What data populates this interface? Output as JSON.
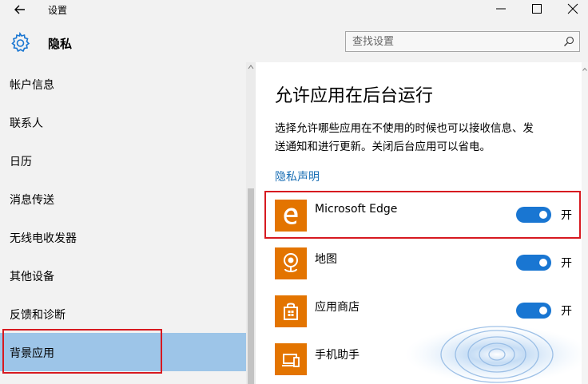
{
  "window": {
    "title": "设置",
    "back_icon": "back-arrow-icon",
    "minimize_icon": "minimize-icon",
    "maximize_icon": "maximize-icon",
    "close_icon": "close-icon"
  },
  "header": {
    "icon": "gear-icon",
    "title": "隐私"
  },
  "search": {
    "placeholder": "查找设置",
    "icon": "search-icon"
  },
  "sidebar": {
    "items": [
      {
        "label": "帐户信息",
        "active": false
      },
      {
        "label": "联系人",
        "active": false
      },
      {
        "label": "日历",
        "active": false
      },
      {
        "label": "消息传送",
        "active": false
      },
      {
        "label": "无线电收发器",
        "active": false
      },
      {
        "label": "其他设备",
        "active": false
      },
      {
        "label": "反馈和诊断",
        "active": false
      },
      {
        "label": "背景应用",
        "active": true
      }
    ]
  },
  "main": {
    "title": "允许应用在后台运行",
    "description_line1": "选择允许哪些应用在不使用的时候也可以接收信息、发",
    "description_line2": "送通知和进行更新。关闭后台应用可以省电。",
    "privacy_link": "隐私声明",
    "apps": [
      {
        "name": "Microsoft Edge",
        "icon": "edge-icon",
        "toggle_on": true,
        "toggle_label": "开"
      },
      {
        "name": "地图",
        "icon": "maps-icon",
        "toggle_on": true,
        "toggle_label": "开"
      },
      {
        "name": "应用商店",
        "icon": "store-icon",
        "toggle_on": true,
        "toggle_label": "开"
      },
      {
        "name": "手机助手",
        "icon": "phone-companion-icon"
      }
    ]
  },
  "colors": {
    "accent": "#1976d2",
    "app_tile": "#e37400",
    "sidebar_selected": "#9dc5e8",
    "highlight_box": "#d71920",
    "link": "#1a6fb5"
  }
}
